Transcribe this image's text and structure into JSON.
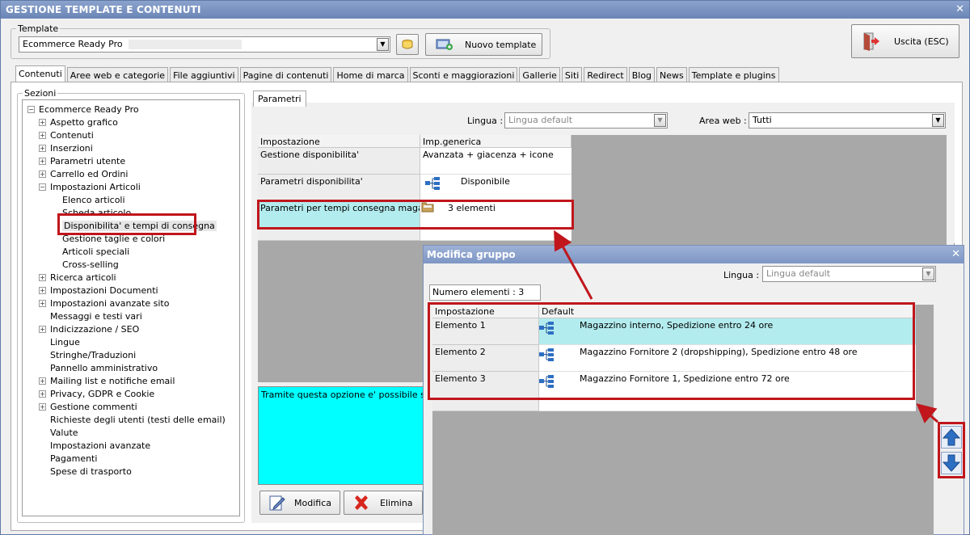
{
  "window": {
    "title": "GESTIONE TEMPLATE E CONTENUTI",
    "close": "✕"
  },
  "template": {
    "legend": "Template",
    "selected": "Ecommerce Ready Pro",
    "new_button": "Nuovo template",
    "exit_button": "Uscita (ESC)"
  },
  "tabs": [
    "Contenuti",
    "Aree web e categorie",
    "File aggiuntivi",
    "Pagine di contenuti",
    "Home di marca",
    "Sconti e maggiorazioni",
    "Gallerie",
    "Siti",
    "Redirect",
    "Blog",
    "News",
    "Template e plugins"
  ],
  "sections": {
    "legend": "Sezioni",
    "root": "Ecommerce Ready Pro",
    "items": [
      {
        "label": "Aspetto grafico",
        "level": 1,
        "pm": "+"
      },
      {
        "label": "Contenuti",
        "level": 1,
        "pm": "+"
      },
      {
        "label": "Inserzioni",
        "level": 1,
        "pm": "+"
      },
      {
        "label": "Parametri utente",
        "level": 1,
        "pm": "+"
      },
      {
        "label": "Carrello ed Ordini",
        "level": 1,
        "pm": "+"
      },
      {
        "label": "Impostazioni Articoli",
        "level": 1,
        "pm": "−"
      },
      {
        "label": "Elenco articoli",
        "level": 2,
        "pm": ""
      },
      {
        "label": "Scheda articolo",
        "level": 2,
        "pm": ""
      },
      {
        "label": "Disponibilita' e tempi di consegna",
        "level": 2,
        "pm": "",
        "selected": true
      },
      {
        "label": "Gestione taglie e colori",
        "level": 2,
        "pm": ""
      },
      {
        "label": "Articoli speciali",
        "level": 2,
        "pm": ""
      },
      {
        "label": "Cross-selling",
        "level": 2,
        "pm": ""
      },
      {
        "label": "Ricerca articoli",
        "level": 1,
        "pm": "+"
      },
      {
        "label": "Impostazioni Documenti",
        "level": 1,
        "pm": "+"
      },
      {
        "label": "Impostazioni avanzate sito",
        "level": 1,
        "pm": "+"
      },
      {
        "label": "Messaggi e testi vari",
        "level": 1,
        "pm": ""
      },
      {
        "label": "Indicizzazione / SEO",
        "level": 1,
        "pm": "+"
      },
      {
        "label": "Lingue",
        "level": 1,
        "pm": ""
      },
      {
        "label": "Stringhe/Traduzioni",
        "level": 1,
        "pm": ""
      },
      {
        "label": "Pannello amministrativo",
        "level": 1,
        "pm": ""
      },
      {
        "label": "Mailing list e notifiche email",
        "level": 1,
        "pm": "+"
      },
      {
        "label": "Privacy, GDPR e Cookie",
        "level": 1,
        "pm": "+"
      },
      {
        "label": "Gestione commenti",
        "level": 1,
        "pm": "+"
      },
      {
        "label": "Richieste degli utenti (testi delle email)",
        "level": 1,
        "pm": ""
      },
      {
        "label": "Valute",
        "level": 1,
        "pm": ""
      },
      {
        "label": "Impostazioni avanzate",
        "level": 1,
        "pm": ""
      },
      {
        "label": "Pagamenti",
        "level": 1,
        "pm": ""
      },
      {
        "label": "Spese di trasporto",
        "level": 1,
        "pm": ""
      }
    ]
  },
  "params": {
    "tab": "Parametri",
    "lingua_label": "Lingua :",
    "lingua_value": "Lingua default",
    "area_label": "Area web :",
    "area_value": "Tutti",
    "col_setting": "Impostazione",
    "col_value": "Imp.generica",
    "rows": [
      {
        "setting": "Gestione disponibilita'",
        "value": "Avanzata + giacenza + icone"
      },
      {
        "setting": "Parametri disponibilita'",
        "value": "Disponibile"
      },
      {
        "setting": "Parametri per tempi consegna magazzini",
        "value": "3 elementi"
      }
    ],
    "description": "Tramite questa opzione e' possibile specific",
    "edit_button": "Modifica",
    "delete_button": "Elimina"
  },
  "dialog": {
    "title": "Modifica gruppo",
    "close": "✕",
    "lingua_label": "Lingua :",
    "lingua_value": "Lingua default",
    "count_label": "Numero elementi : 3",
    "col_setting": "Impostazione",
    "col_value": "Default",
    "rows": [
      {
        "setting": "Elemento 1",
        "value": "Magazzino interno, Spedizione entro 24 ore"
      },
      {
        "setting": "Elemento 2",
        "value": "Magazzino Fornitore 2 (dropshipping), Spedizione entro 48 ore"
      },
      {
        "setting": "Elemento 3",
        "value": "Magazzino Fornitore 1, Spedizione entro 72 ore"
      }
    ]
  },
  "colors": {
    "highlight": "#c0161c",
    "selected_row": "#b3ecee",
    "description_bg": "#00ffff",
    "arrow_blue": "#2d6fc2"
  }
}
